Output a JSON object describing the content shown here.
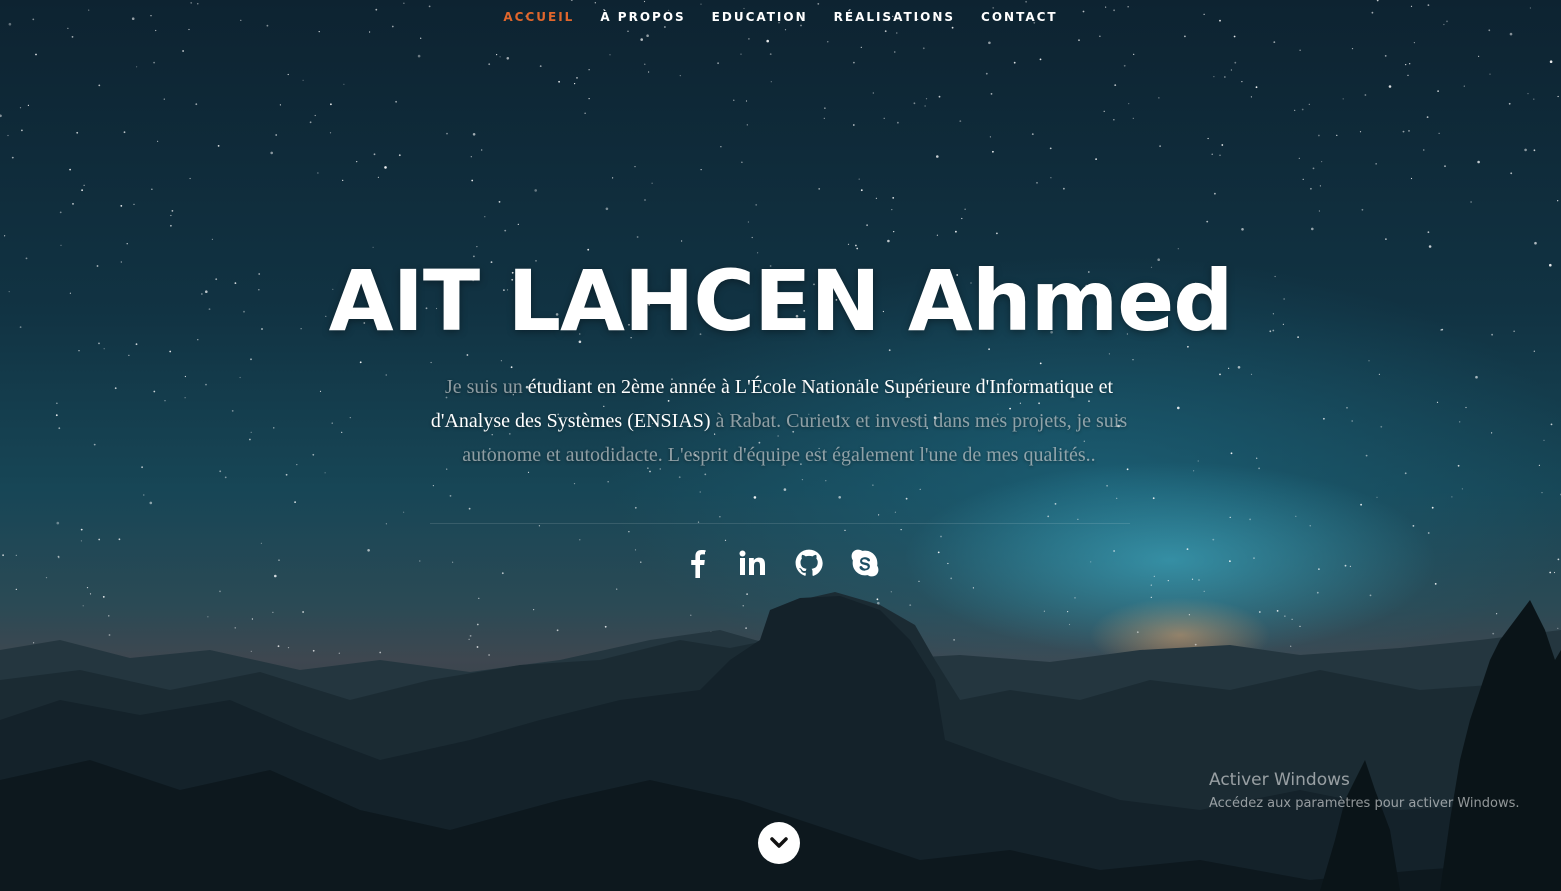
{
  "nav": {
    "items": [
      {
        "label": "ACCUEIL",
        "active": true
      },
      {
        "label": "À PROPOS",
        "active": false
      },
      {
        "label": "EDUCATION",
        "active": false
      },
      {
        "label": "RÉALISATIONS",
        "active": false
      },
      {
        "label": "CONTACT",
        "active": false
      }
    ],
    "active_color": "#e0662c"
  },
  "hero": {
    "title": "AIT LAHCEN Ahmed",
    "intro": {
      "part1": "Je suis un ",
      "part2": "étudiant en 2ème année à L'École Nationale Supérieure d'Informatique et d'Analyse des Systèmes (ENSIAS)",
      "part3": " à Rabat. Curieux et investi dans mes projets, je suis autonome et autodidacte. L'esprit d'équipe est également l'une de mes qualités.."
    }
  },
  "socials": [
    {
      "name": "facebook-icon"
    },
    {
      "name": "linkedin-icon"
    },
    {
      "name": "github-icon"
    },
    {
      "name": "skype-icon"
    }
  ],
  "scroll_button": {
    "icon": "chevron-down-icon"
  },
  "watermark": {
    "title": "Activer Windows",
    "subtitle": "Accédez aux paramètres pour activer Windows."
  }
}
